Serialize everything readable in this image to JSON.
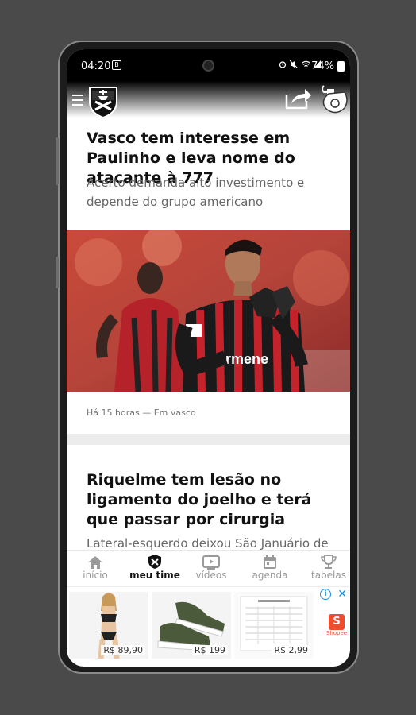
{
  "status_bar": {
    "time": "04:20",
    "notification_glyph": "B",
    "icons": [
      "alarm-icon",
      "mute-icon",
      "wifi-icon",
      "signal-icon"
    ],
    "battery": "74%"
  },
  "app": {
    "brand": "vasco-crest",
    "actions": [
      "share-icon",
      "whistle-icon"
    ]
  },
  "articles": [
    {
      "title": "Vasco tem interesse em Paulinho e leva nome do atacante à 777",
      "subtitle": "Acerto demanda alto investimento e depende do grupo americano",
      "meta": "Há 15 horas — Em vasco",
      "image": "football-player-applauding"
    },
    {
      "title": "Riquelme tem lesão no ligamento do joelho e terá que passar por cirurgia",
      "subtitle": "Lateral-esquerdo deixou São Januário de"
    }
  ],
  "nav": {
    "items": [
      {
        "label": "início",
        "icon": "home-icon",
        "active": false
      },
      {
        "label": "meu time",
        "icon": "shield-icon",
        "active": true
      },
      {
        "label": "vídeos",
        "icon": "play-icon",
        "active": false
      },
      {
        "label": "agenda",
        "icon": "calendar-icon",
        "active": false
      },
      {
        "label": "tabelas",
        "icon": "trophy-icon",
        "active": false
      }
    ]
  },
  "ad": {
    "products": [
      {
        "price": "R$ 89,90",
        "image": "bikini"
      },
      {
        "price": "R$ 199",
        "image": "sneaker"
      },
      {
        "price": "R$ 2,99",
        "image": "price-table"
      }
    ],
    "advertiser": "Shopee",
    "advertiser_glyph": "S",
    "info_glyph": "i",
    "close_glyph": "✕"
  },
  "colors": {
    "accent": "#111111",
    "inactive": "#9a9a9a",
    "shopee": "#ee4d2d",
    "adchoices": "#1a8fe3"
  }
}
